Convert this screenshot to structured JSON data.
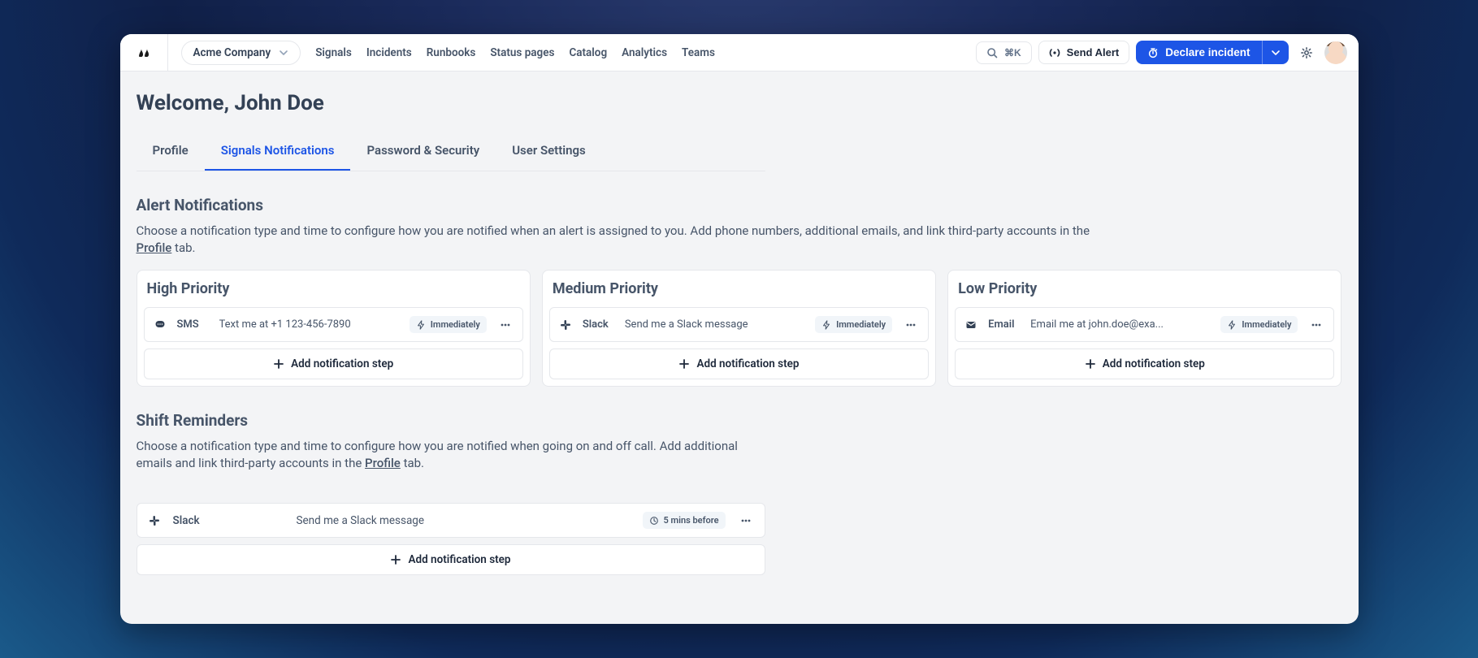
{
  "header": {
    "company_name": "Acme Company",
    "nav": [
      "Signals",
      "Incidents",
      "Runbooks",
      "Status pages",
      "Catalog",
      "Analytics",
      "Teams"
    ],
    "search_shortcut": "⌘K",
    "send_alert_label": "Send Alert",
    "declare_incident_label": "Declare incident"
  },
  "page": {
    "title": "Welcome, John Doe",
    "tabs": [
      "Profile",
      "Signals Notifications",
      "Password & Security",
      "User Settings"
    ],
    "active_tab_index": 1
  },
  "alert_notifications": {
    "title": "Alert Notifications",
    "description_pre": "Choose a notification type and time to configure how you are notified when an alert is assigned to you. Add phone numbers, additional emails, and link third-party accounts in the ",
    "profile_link_label": "Profile",
    "description_post": " tab.",
    "priorities": [
      {
        "title": "High Priority",
        "channel": "SMS",
        "channel_icon": "chat",
        "description": "Text me at +1 123-456-7890",
        "timing": "Immediately",
        "timing_icon": "bolt"
      },
      {
        "title": "Medium Priority",
        "channel": "Slack",
        "channel_icon": "slack",
        "description": "Send me a Slack message",
        "timing": "Immediately",
        "timing_icon": "bolt"
      },
      {
        "title": "Low Priority",
        "channel": "Email",
        "channel_icon": "email",
        "description": "Email me at john.doe@exa...",
        "timing": "Immediately",
        "timing_icon": "bolt"
      }
    ],
    "add_step_label": "Add notification step"
  },
  "shift_reminders": {
    "title": "Shift Reminders",
    "description_pre": "Choose a notification type and time to configure how you are notified when going on and off call. Add additional emails and link third-party accounts in the ",
    "profile_link_label": "Profile",
    "description_post": " tab.",
    "step": {
      "channel": "Slack",
      "channel_icon": "slack",
      "description": "Send me a Slack message",
      "timing": "5 mins before",
      "timing_icon": "clock"
    },
    "add_step_label": "Add notification step"
  }
}
